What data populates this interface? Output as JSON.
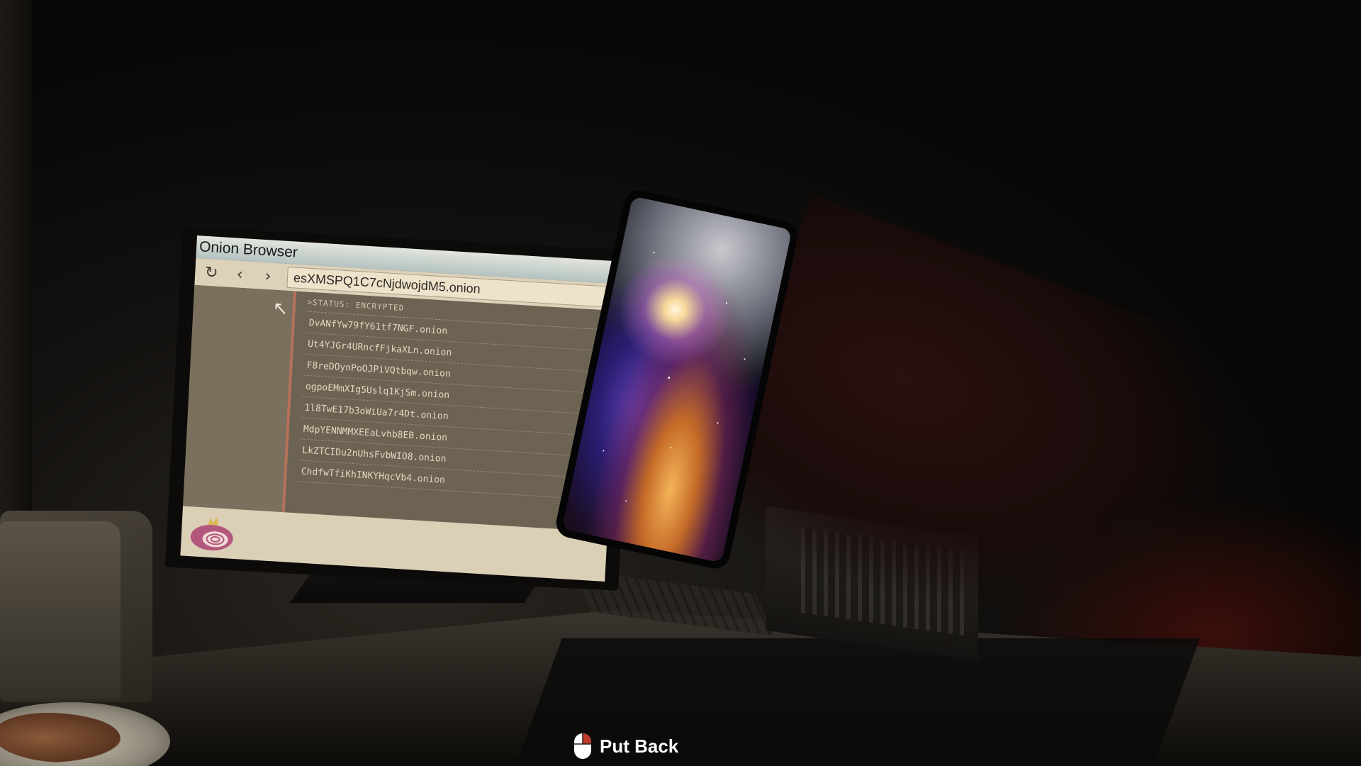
{
  "browser": {
    "title": "Onion Browser",
    "url": "esXMSPQ1C7cNjdwojdM5.onion",
    "status": ">STATUS: ENCRYPTED",
    "links": [
      "DvANfYw79fY61tf7NGF.onion",
      "Ut4YJGr4URncfFjkaXLn.onion",
      "F8reDOynPoOJPiVQtbqw.onion",
      "ogpoEMmXIg5Uslq1KjSm.onion",
      "1l8TwE17b3oWiUa7r4Dt.onion",
      "MdpYENNMMXEEaLvhb8EB.onion",
      "LkZTCIDu2nUhsFvbWIO8.onion",
      "ChdfwTfiKhINKYHqcVb4.onion"
    ]
  },
  "prompt": {
    "label": "Put Back",
    "icon": "mouse-right-click-icon"
  },
  "colors": {
    "accent": "#c56b55",
    "titlebar": "#a6c4d2",
    "prompt_text": "#ffffff"
  }
}
